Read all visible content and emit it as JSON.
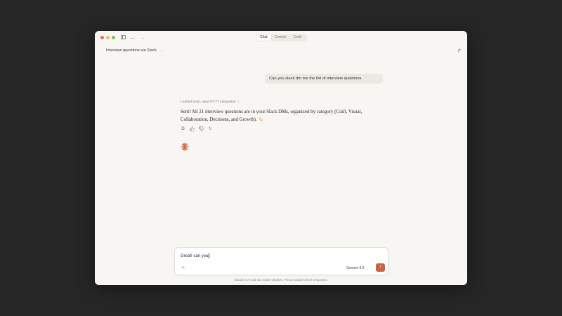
{
  "titlebar": {
    "tabs": [
      "Chat",
      "Cowork",
      "Code"
    ],
    "active_tab": "Chat"
  },
  "header": {
    "conversation_title": "Interview questions via Slack"
  },
  "messages": {
    "user": "Can you slack dm me the list of interview questions",
    "tools_status": "Loaded tools, used IFTTT integration",
    "assistant": "Sent! All 21 interview questions are in your Slack DMs, organized by category (Craft, Visual, Collaboration, Decisions, and Growth).",
    "assistant_emoji": "🏷️"
  },
  "composer": {
    "value": "Great! can you",
    "model": "Sonnet 4.6"
  },
  "footer": {
    "disclaimer": "Claude is AI and can make mistakes. Please double-check responses."
  },
  "colors": {
    "accent": "#c96442",
    "window_bg": "#f7f6f2",
    "desktop_bg": "#262626"
  },
  "icons": {
    "sidebar": "sidebar-toggle-icon",
    "back": "arrow-left-icon",
    "forward": "arrow-right-icon",
    "share": "share-icon",
    "copy": "copy-icon",
    "thumbs_up": "thumbs-up-icon",
    "thumbs_down": "thumbs-down-icon",
    "retry": "retry-icon",
    "spark": "claude-spark-icon",
    "add": "plus-icon",
    "send": "arrow-up-icon"
  }
}
